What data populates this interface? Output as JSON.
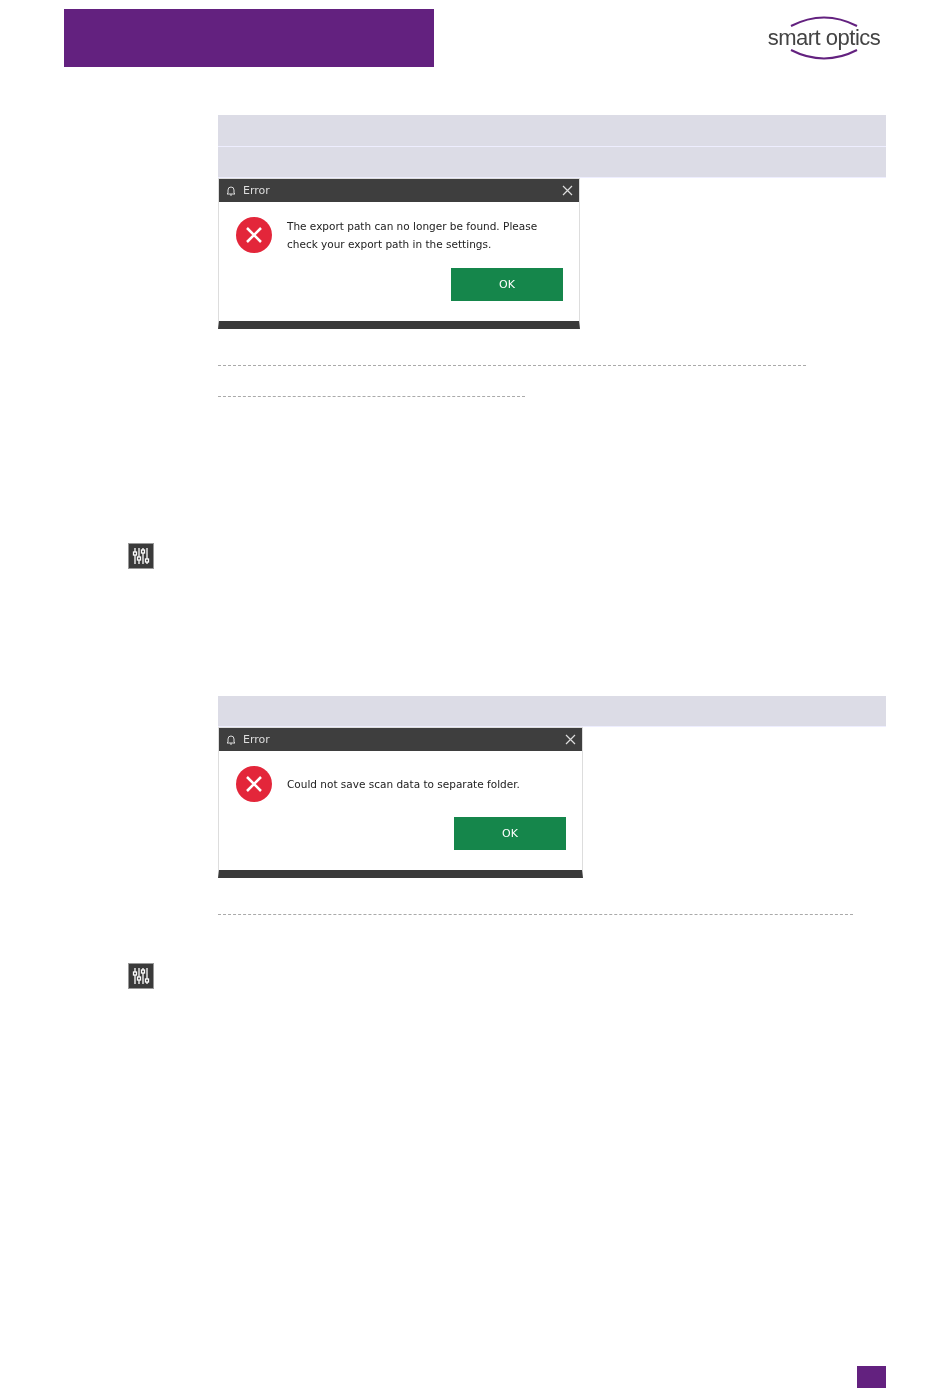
{
  "logo": {
    "text": "smart optics"
  },
  "dialogs": [
    {
      "title": "Error",
      "message": "The export path can no longer be found. Please check your export path in the settings.",
      "button": "OK"
    },
    {
      "title": "Error",
      "message": "Could not save scan data to separate folder.",
      "button": "OK"
    }
  ]
}
